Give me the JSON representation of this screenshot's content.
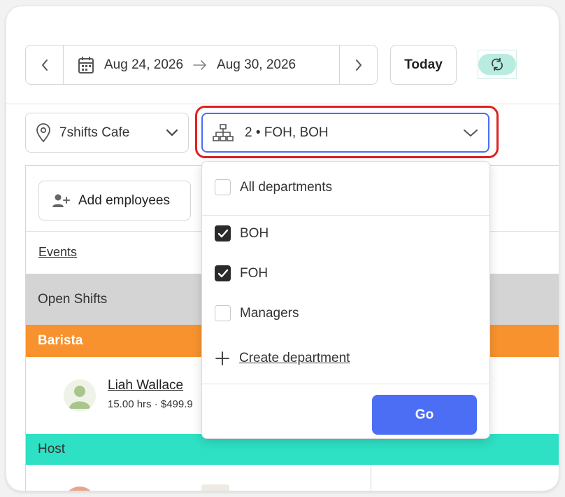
{
  "header": {
    "prev_icon": "chevron-left-icon",
    "next_icon": "chevron-right-icon",
    "calendar_icon": "calendar-icon",
    "start_date": "Aug 24, 2026",
    "end_date": "Aug 30, 2026",
    "today_label": "Today",
    "sync_icon": "sync-icon"
  },
  "filters": {
    "location": {
      "icon": "location-pin-icon",
      "label": "7shifts Cafe"
    },
    "department": {
      "icon": "org-chart-icon",
      "label": "2 • FOH, BOH"
    }
  },
  "toolbar": {
    "add_employees_label": "Add employees"
  },
  "schedule": {
    "events_label": "Events",
    "open_shifts_label": "Open Shifts",
    "roles": [
      {
        "name": "Barista",
        "color": "#f7922e"
      },
      {
        "name": "Host",
        "color": "#2ee0c4"
      }
    ],
    "employee": {
      "name": "Liah Wallace",
      "meta": "15.00 hrs · $499.9"
    }
  },
  "dropdown": {
    "all_label": "All departments",
    "options": [
      {
        "label": "BOH",
        "checked": true
      },
      {
        "label": "FOH",
        "checked": true
      },
      {
        "label": "Managers",
        "checked": false
      }
    ],
    "create_label": "Create department",
    "go_label": "Go"
  },
  "colors": {
    "accent": "#4c6ef5",
    "highlight": "#e02020"
  }
}
